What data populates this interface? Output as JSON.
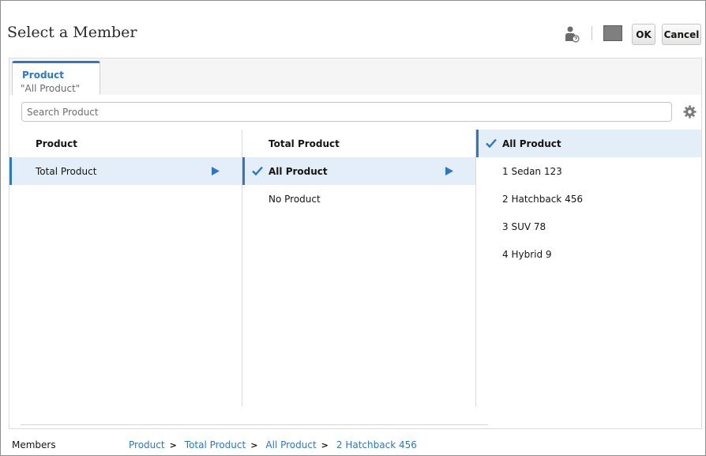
{
  "dialog": {
    "title": "Select a Member",
    "ok_label": "OK",
    "cancel_label": "Cancel",
    "header_icons": [
      "member-info-icon",
      "color-swatch-icon"
    ],
    "swatch_color": "#7f7f7f"
  },
  "tab": {
    "title": "Product",
    "subtitle": "\"All Product\""
  },
  "search": {
    "placeholder": "Search Product",
    "value": ""
  },
  "columns": [
    {
      "header": "Product",
      "rows": [
        {
          "label": "Total Product",
          "selected": true,
          "checked": false,
          "has_children": true
        }
      ]
    },
    {
      "header": "Total Product",
      "rows": [
        {
          "label": "All Product",
          "selected": true,
          "checked": true,
          "has_children": true
        },
        {
          "label": "No Product",
          "selected": false,
          "checked": false,
          "has_children": false
        }
      ]
    },
    {
      "header": "All Product",
      "header_selected": true,
      "header_checked": true,
      "rows": [
        {
          "label": "1 Sedan 123"
        },
        {
          "label": "2 Hatchback 456"
        },
        {
          "label": "3 SUV 78"
        },
        {
          "label": "4 Hybrid 9"
        }
      ]
    }
  ],
  "footer": {
    "label": "Members",
    "breadcrumb": [
      "Product",
      "Total Product",
      "All Product",
      "2 Hatchback 456"
    ]
  },
  "colors": {
    "accent": "#2d77c8",
    "selected_row": "#e4eef8"
  }
}
